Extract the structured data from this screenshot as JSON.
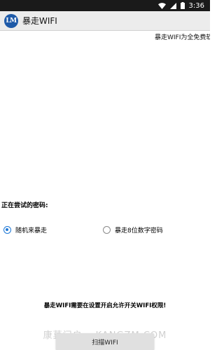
{
  "status_bar": {
    "time": "3:36",
    "icons": [
      "wifi-icon",
      "signal-icon",
      "battery-icon"
    ]
  },
  "app_bar": {
    "logo_text": "LM",
    "title": "暴走WIFI"
  },
  "marquee": {
    "text": "暴走WIFI为全免费软"
  },
  "main": {
    "attempt_label": "正在尝试的密码:",
    "radio_options": [
      {
        "label": "随机来暴走",
        "checked": true
      },
      {
        "label": "暴走8位数字密码",
        "checked": false
      }
    ],
    "permission_note": "暴走WIFI需要在设置开启允许开关WIFI权限!",
    "scan_button": "扫描WIFI"
  },
  "watermark": "康莫门户 • KANGZM.COM",
  "colors": {
    "status_bar": "#1a1a1a",
    "app_bar": "#ececec",
    "accent": "#1e78d6",
    "logo": "#1e5aa8"
  }
}
